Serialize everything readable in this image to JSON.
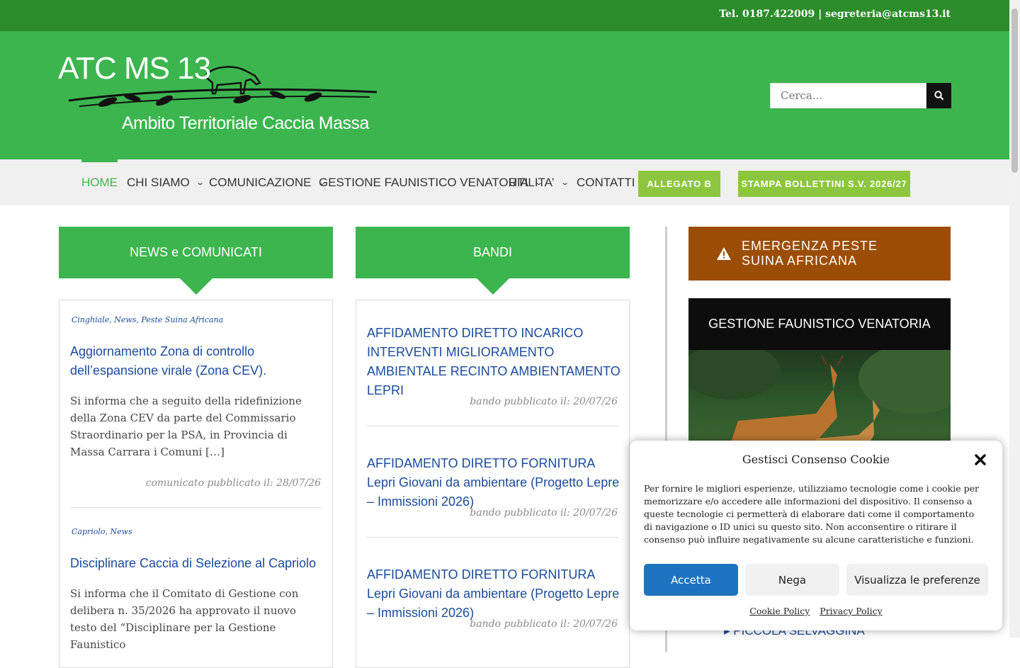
{
  "topbar": {
    "contact": "Tel. 0187.422009 | segreteria@atcms13.it"
  },
  "logo": {
    "main": "ATC MS 13",
    "sub": "Ambito Territoriale Caccia Massa"
  },
  "search": {
    "placeholder": "Cerca..."
  },
  "nav": {
    "items": [
      {
        "label": "HOME"
      },
      {
        "label": "CHI SIAMO"
      },
      {
        "label": "COMUNICAZIONE"
      },
      {
        "label": "GESTIONE FAUNISTICO VENATORIA"
      },
      {
        "label": "UTILITA’"
      },
      {
        "label": "CONTATTI"
      }
    ],
    "buttons": [
      {
        "label": "ALLEGATO B"
      },
      {
        "label": "STAMPA BOLLETTINI S.V. 2026/27"
      }
    ]
  },
  "news": {
    "heading": "NEWS e COMUNICATI",
    "posts": [
      {
        "cats": "Cinghiale, News, Peste Suina Africana",
        "title": "Aggiornamento Zona di controllo dell’espansione virale (Zona CEV).",
        "excerpt": "Si informa che a seguito della ridefinizione della Zona CEV da parte del Commissario Straordinario per la PSA, in Provincia di Massa Carrara i Comuni […]",
        "meta": "comunicato pubblicato il: 28/07/26"
      },
      {
        "cats": "Capriolo, News",
        "title": "Disciplinare Caccia di Selezione al Capriolo",
        "excerpt": "Si informa che il Comitato di Gestione con delibera n. 35/2026 ha approvato il nuovo testo del “Disciplinare per la Gestione Faunistico",
        "meta": ""
      }
    ]
  },
  "bandi": {
    "heading": "BANDI",
    "posts": [
      {
        "title": "AFFIDAMENTO DIRETTO INCARICO INTERVENTI MIGLIORAMENTO AMBIENTALE RECINTO AMBIENTAMENTO LEPRI",
        "meta": "bando pubblicato il: 20/07/26"
      },
      {
        "title": "AFFIDAMENTO DIRETTO FORNITURA Lepri Giovani da ambientare (Progetto Lepre – Immissioni 2026)",
        "meta": "bando pubblicato il: 20/07/26"
      },
      {
        "title": "AFFIDAMENTO DIRETTO FORNITURA Lepri Giovani da ambientare (Progetto Lepre – Immissioni 2026)",
        "meta": "bando pubblicato il: 20/07/26"
      }
    ]
  },
  "sidebar": {
    "alert": "EMERGENZA PESTE SUINA AFRICANA",
    "gfv_heading": "GESTIONE FAUNISTICO VENATORIA",
    "link": "PICCOLA SELVAGGINA"
  },
  "cookie": {
    "title": "Gestisci Consenso Cookie",
    "body": "Per fornire le migliori esperienze, utilizziamo tecnologie come i cookie per memorizzare e/o accedere alle informazioni del dispositivo. Il consenso a queste tecnologie ci permetterà di elaborare dati come il comportamento di navigazione o ID unici su questo sito. Non acconsentire o ritirare il consenso può influire negativamente su alcune caratteristiche e funzioni.",
    "accept": "Accetta",
    "deny": "Nega",
    "prefs": "Visualizza le preferenze",
    "cookie_policy": "Cookie Policy",
    "privacy_policy": "Privacy Policy"
  },
  "colors": {
    "green_dark": "#2c8c2a",
    "green": "#3cb54f",
    "lime": "#8cc63f",
    "alert": "#9c4d05",
    "link": "#1a4b9b",
    "accept": "#1e73be"
  }
}
